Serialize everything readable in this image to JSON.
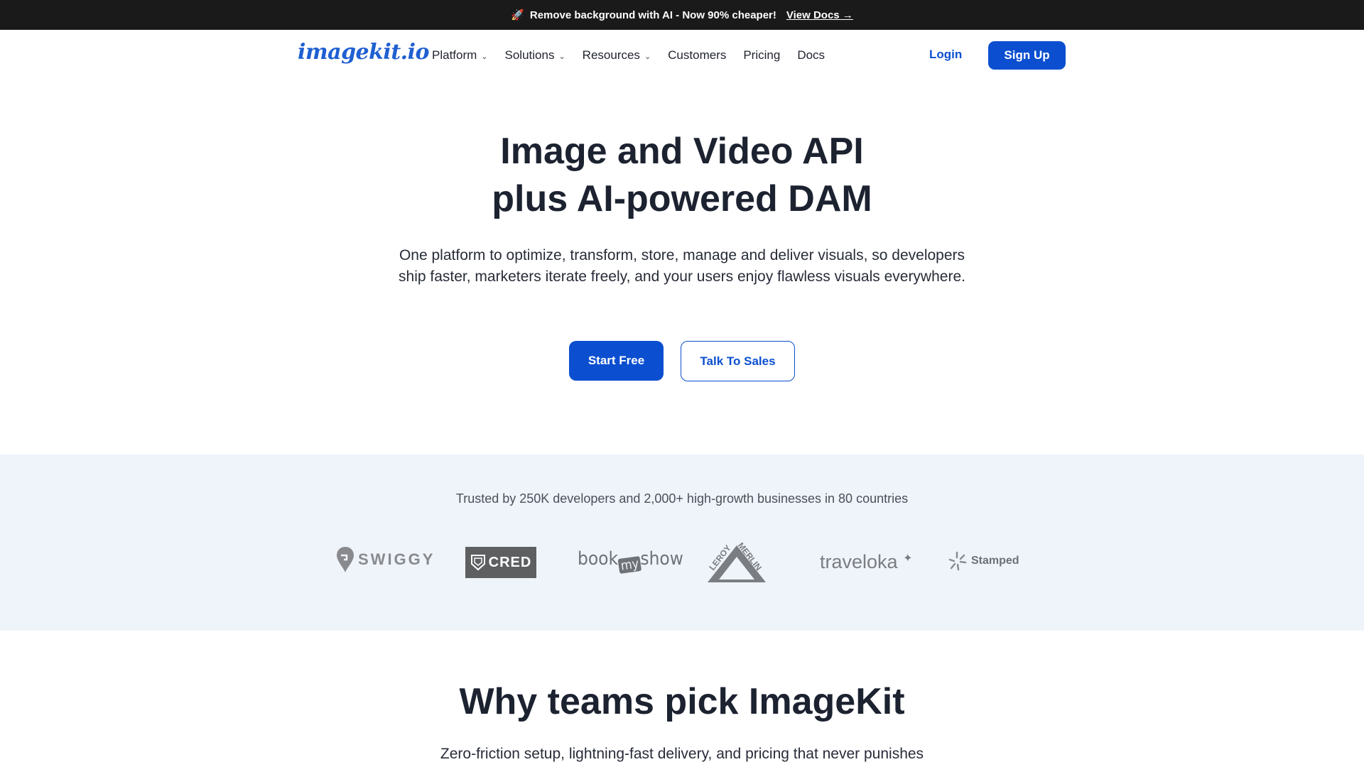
{
  "announcement": {
    "icon": "rocket-icon",
    "text": "Remove background with AI - Now 90% cheaper!",
    "link": "View Docs →"
  },
  "nav": {
    "logo": "imagekit.io",
    "items": [
      {
        "label": "Platform",
        "dropdown": true
      },
      {
        "label": "Solutions",
        "dropdown": true
      },
      {
        "label": "Resources",
        "dropdown": true
      },
      {
        "label": "Customers",
        "dropdown": false
      },
      {
        "label": "Pricing",
        "dropdown": false
      },
      {
        "label": "Docs",
        "dropdown": false
      }
    ],
    "login": "Login",
    "signup": "Sign Up"
  },
  "hero": {
    "title_line1": "Image and Video API",
    "title_line2": "plus AI-powered DAM",
    "subtitle": "One platform to optimize, transform, store, manage and deliver visuals, so developers ship faster, marketers iterate freely, and your users enjoy flawless visuals everywhere.",
    "primary_cta": "Start Free",
    "secondary_cta": "Talk To Sales"
  },
  "trusted": {
    "text": "Trusted by 250K developers and 2,000+ high-growth businesses in 80 countries",
    "logos": {
      "swiggy": "SWIGGY",
      "cred": "CRED",
      "bookmyshow_book": "book",
      "bookmyshow_my": "my",
      "bookmyshow_show": "show",
      "leroy": "LEROY MERLIN",
      "traveloka": "traveloka",
      "stamped": "Stamped"
    }
  },
  "why": {
    "title": "Why teams pick ImageKit",
    "subtitle": "Zero-friction setup, lightning-fast delivery, and pricing that never punishes"
  },
  "colors": {
    "brand": "#0b4fd0",
    "announce_bg": "#1a1a1a",
    "trusted_bg": "#eff4fa"
  }
}
